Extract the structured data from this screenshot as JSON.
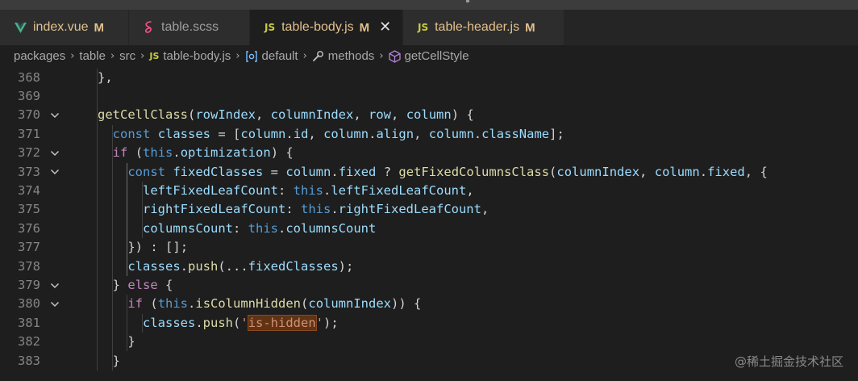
{
  "tabs": [
    {
      "name": "index.vue",
      "modified": "M",
      "icon": "vue-icon",
      "active": false
    },
    {
      "name": "table.scss",
      "modified": "",
      "icon": "sass-icon",
      "active": false
    },
    {
      "name": "table-body.js",
      "modified": "M",
      "icon": "js-icon",
      "active": true,
      "close": "✕"
    },
    {
      "name": "table-header.js",
      "modified": "M",
      "icon": "js-icon",
      "active": false
    }
  ],
  "js_badge": "JS",
  "breadcrumb": {
    "items": [
      "packages",
      "table",
      "src",
      "table-body.js",
      "default",
      "methods",
      "getCellStyle"
    ],
    "separator": "›"
  },
  "editor": {
    "lines": [
      {
        "num": "368",
        "fold": false,
        "code": "    },"
      },
      {
        "num": "369",
        "fold": false,
        "code": ""
      },
      {
        "num": "370",
        "fold": true,
        "code": "    getCellClass(rowIndex, columnIndex, row, column) {"
      },
      {
        "num": "371",
        "fold": false,
        "code": "      const classes = [column.id, column.align, column.className];"
      },
      {
        "num": "372",
        "fold": true,
        "code": "      if (this.optimization) {"
      },
      {
        "num": "373",
        "fold": true,
        "code": "        const fixedClasses = column.fixed ? getFixedColumnsClass(columnIndex, column.fixed, {"
      },
      {
        "num": "374",
        "fold": false,
        "code": "          leftFixedLeafCount: this.leftFixedLeafCount,"
      },
      {
        "num": "375",
        "fold": false,
        "code": "          rightFixedLeafCount: this.rightFixedLeafCount,"
      },
      {
        "num": "376",
        "fold": false,
        "code": "          columnsCount: this.columnsCount"
      },
      {
        "num": "377",
        "fold": false,
        "code": "        }) : [];"
      },
      {
        "num": "378",
        "fold": false,
        "code": "        classes.push(...fixedClasses);"
      },
      {
        "num": "379",
        "fold": true,
        "code": "      } else {"
      },
      {
        "num": "380",
        "fold": true,
        "code": "        if (this.isColumnHidden(columnIndex)) {"
      },
      {
        "num": "381",
        "fold": false,
        "code": "          classes.push('is-hidden');"
      },
      {
        "num": "382",
        "fold": false,
        "code": "        }"
      },
      {
        "num": "383",
        "fold": false,
        "code": "      }"
      }
    ]
  },
  "watermark": "@稀土掘金技术社区",
  "colors": {
    "background": "#1e1e1e",
    "tab_bar": "#252526",
    "modified": "#e2c08d",
    "js": "#cbcb41",
    "vue": "#41b883",
    "sass": "#f55385",
    "keyword": "#569cd6",
    "control": "#c586c0",
    "function": "#dcdcaa",
    "variable": "#9cdcfe",
    "string": "#ce9178"
  }
}
